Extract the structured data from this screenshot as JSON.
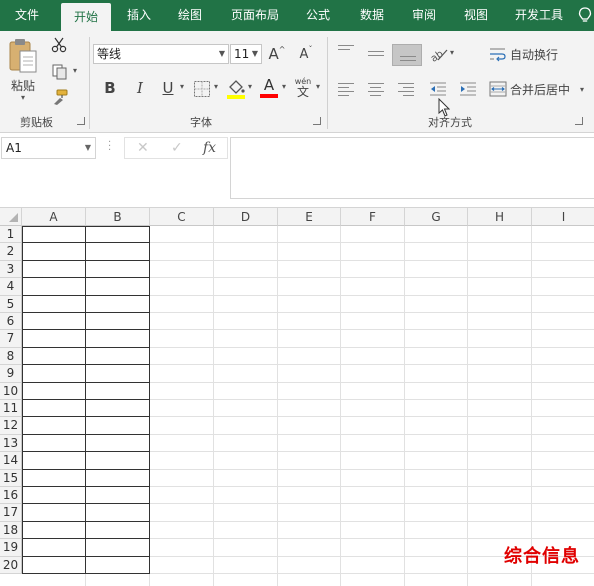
{
  "tabs": [
    "文件",
    "开始",
    "插入",
    "绘图",
    "页面布局",
    "公式",
    "数据",
    "审阅",
    "视图",
    "开发工具"
  ],
  "active_tab": 1,
  "clipboard": {
    "paste_label": "粘贴",
    "group_label": "剪贴板"
  },
  "font": {
    "name_value": "等线",
    "size_value": "11",
    "bold": "B",
    "italic": "I",
    "underline": "U",
    "grow": "A",
    "shrink": "A",
    "color_glyph": "A",
    "phonetic_top": "wén",
    "phonetic_bottom": "文",
    "group_label": "字体",
    "highlight_color": "#ffff00",
    "font_color": "#ff0000"
  },
  "alignment": {
    "wrap_label": "自动换行",
    "merge_label": "合并后居中",
    "group_label": "对齐方式"
  },
  "formula_bar": {
    "name_box_value": "A1",
    "fx_label": "fx"
  },
  "columns": [
    "A",
    "B",
    "C",
    "D",
    "E",
    "F",
    "G",
    "H",
    "I"
  ],
  "rows": [
    "1",
    "2",
    "3",
    "4",
    "5",
    "6",
    "7",
    "8",
    "9",
    "10",
    "11",
    "12",
    "13",
    "14",
    "15",
    "16",
    "17",
    "18",
    "19",
    "20"
  ],
  "watermark": "综合信息"
}
